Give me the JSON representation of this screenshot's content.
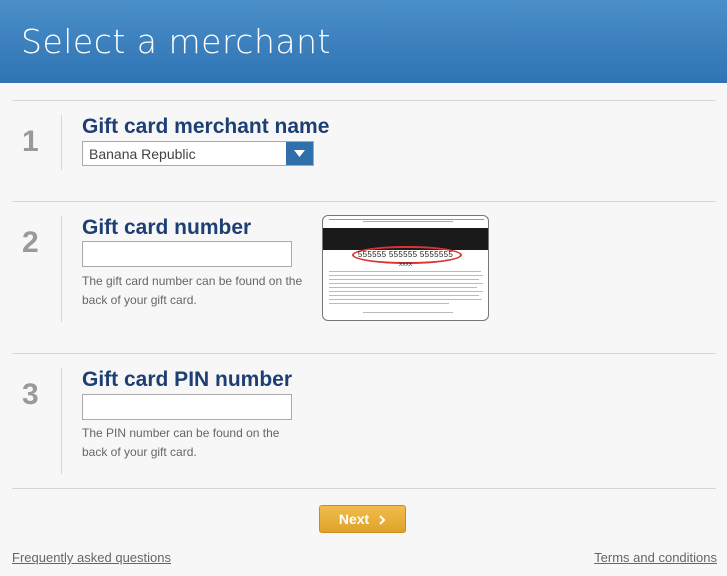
{
  "header": {
    "title": "Select a merchant"
  },
  "steps": [
    {
      "number": "1",
      "title": "Gift card merchant name",
      "select_value": "Banana Republic"
    },
    {
      "number": "2",
      "title": "Gift card number",
      "input_value": "",
      "help": "The gift card number can be found on the back of your gift card.",
      "card_number": "555555 555555 5555555",
      "card_sub": "XXXX"
    },
    {
      "number": "3",
      "title": "Gift card PIN number",
      "input_value": "",
      "help": "The PIN number can be found on the back of your gift card."
    }
  ],
  "next_label": "Next",
  "footer": {
    "faq": "Frequently asked questions",
    "terms": "Terms and conditions"
  },
  "colors": {
    "header": "#3a80bf",
    "title": "#1e3f73",
    "button": "#e6ae38"
  },
  "icons": {
    "select_arrow": "caret-down-icon",
    "next_arrow": "chevron-right-icon"
  }
}
